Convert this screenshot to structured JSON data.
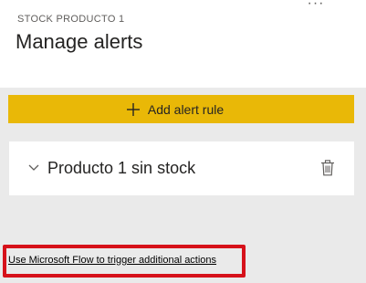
{
  "header": {
    "subtitle": "STOCK PRODUCTO 1",
    "title": "Manage alerts",
    "more_menu": "···"
  },
  "panel": {
    "add_rule_label": "Add alert rule",
    "add_rule_icon": "plus-icon",
    "add_rule_color": "#e9b807",
    "alerts": [
      {
        "name": "Producto 1 sin stock",
        "expand_icon": "chevron-down-icon",
        "delete_icon": "trash-icon"
      }
    ]
  },
  "footer": {
    "flow_link_label": "Use Microsoft Flow to trigger additional actions",
    "highlight_color": "#d6111a"
  }
}
